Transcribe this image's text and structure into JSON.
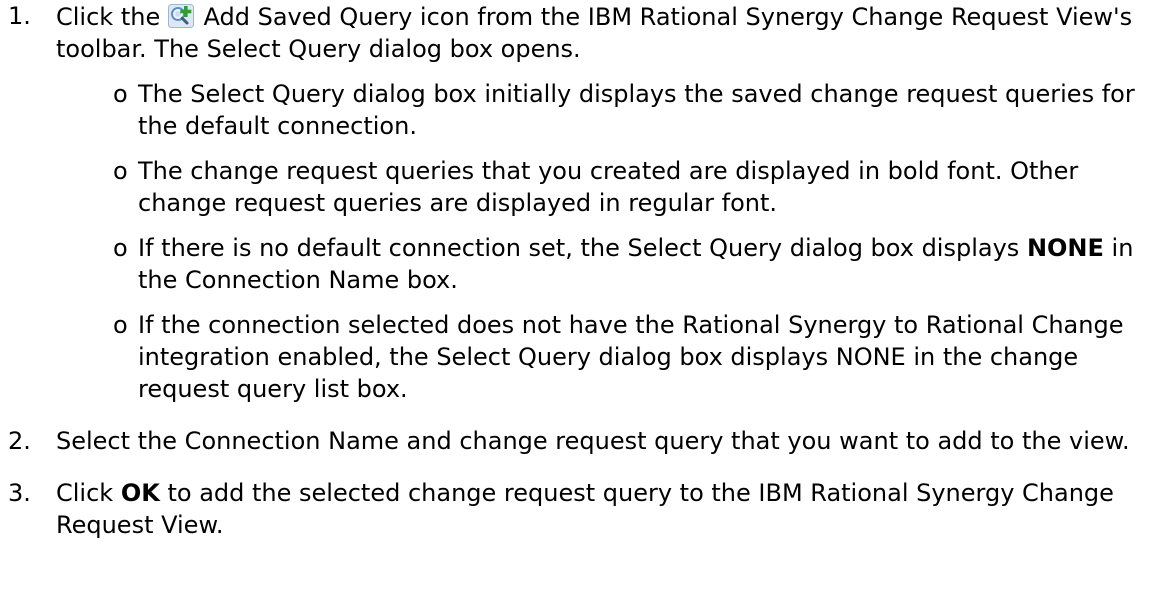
{
  "colors": {
    "text": "#000000",
    "background": "#ffffff",
    "icon_plus": "#2e9e2e",
    "icon_lens": "#5f8fc7"
  },
  "steps": [
    {
      "number": "1.",
      "pre": "Click the",
      "icon": "add-saved-query-icon",
      "post": "Add Saved Query icon from the IBM Rational Synergy Change Request View's toolbar. The Select Query dialog box opens.",
      "subitems": [
        {
          "marker": "o",
          "text": "The Select Query dialog box initially displays the saved change request queries for the default connection."
        },
        {
          "marker": "o",
          "text": "The change request queries that you created are displayed in bold font. Other change request queries are displayed in regular font."
        },
        {
          "marker": "o",
          "pre": "If there is no default connection set, the Select Query dialog box displays",
          "bold": "NONE",
          "post": "in the Connection Name box."
        },
        {
          "marker": "o",
          "text": "If the connection selected does not have the Rational Synergy to Rational Change integration enabled, the Select Query dialog box displays NONE in the change request query list box."
        }
      ]
    },
    {
      "number": "2.",
      "text": "Select the Connection Name and change request query that you want to add to the view."
    },
    {
      "number": "3.",
      "pre": "Click",
      "bold": "OK",
      "post": "to add the selected change request query to the IBM Rational Synergy Change Request View."
    }
  ]
}
